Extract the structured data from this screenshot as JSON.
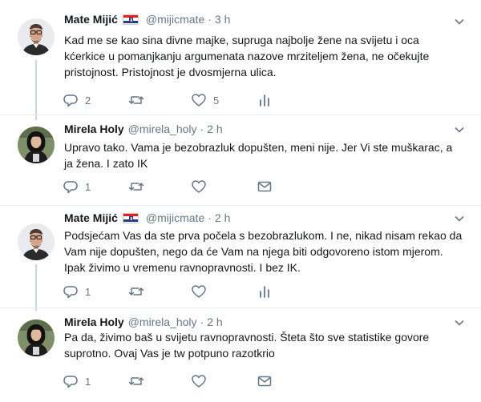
{
  "tweets": [
    {
      "author": "Mate Mijić",
      "handle": "@mijicmate",
      "separator": "·",
      "time": "3 h",
      "text": "Kad me se kao sina divne majke, supruga najbolje žene na svijetu i oca kćerkice u pomanjkanju argumenata nazove mrziteljem žena, ne očekujte pristojnost. Pristojnost je dvosmjerna ulica.",
      "reply_count": "2",
      "retweet_count": "",
      "like_count": "5",
      "extra_icon": "analytics-icon"
    },
    {
      "author": "Mirela Holy",
      "handle": "@mirela_holy",
      "separator": "·",
      "time": "2 h",
      "text": "Upravo tako. Vama je bezobrazluk dopušten, meni nije. Jer Vi ste muškarac, a ja žena. I zato IK",
      "reply_count": "1",
      "retweet_count": "",
      "like_count": "",
      "extra_icon": "direct-message-icon"
    },
    {
      "author": "Mate Mijić",
      "handle": "@mijicmate",
      "separator": "·",
      "time": "2 h",
      "text": "Podsjećam Vas da ste prva počela s bezobrazlukom. I ne, nikad nisam rekao da Vam nije dopušten, nego da će Vam na njega biti odgovoreno istom mjerom. Ipak živimo u vremenu ravnopravnosti. I bez IK.",
      "reply_count": "1",
      "retweet_count": "",
      "like_count": "",
      "extra_icon": "analytics-icon"
    },
    {
      "author": "Mirela Holy",
      "handle": "@mirela_holy",
      "separator": "·",
      "time": "2 h",
      "text": "Pa da, živimo baš u svijetu ravnopravnosti. Šteta što sve statistike govore suprotno. Ovaj Vas je tw potpuno razotkrio",
      "reply_count": "1",
      "retweet_count": "",
      "like_count": "",
      "extra_icon": "direct-message-icon"
    }
  ],
  "colors": {
    "text": "#14171a",
    "secondary": "#657786",
    "thread_line": "#ccd6dd",
    "separator": "#e6ecf0"
  }
}
